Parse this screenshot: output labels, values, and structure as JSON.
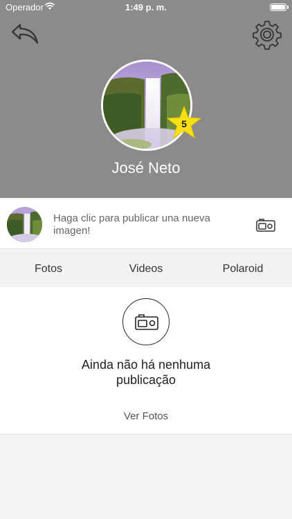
{
  "status_bar": {
    "carrier": "Operador",
    "time": "1:49 p. m."
  },
  "profile": {
    "name": "José Neto",
    "level": "5"
  },
  "post_bar": {
    "prompt": "Haga clic para publicar una nueva imagen!"
  },
  "tabs": [
    {
      "label": "Fotos"
    },
    {
      "label": "Videos"
    },
    {
      "label": "Polaroid"
    }
  ],
  "empty_state": {
    "message": "Ainda não há nenhuma publicação",
    "link_label": "Ver Fotos"
  },
  "icons": {
    "back": "back-arrow-icon",
    "settings": "gear-icon",
    "camera": "camera-icon",
    "badge": "star-icon",
    "wifi": "wifi-icon",
    "battery": "battery-icon"
  },
  "colors": {
    "header_bg": "#8c8a8a",
    "badge_star": "#f7e017"
  }
}
